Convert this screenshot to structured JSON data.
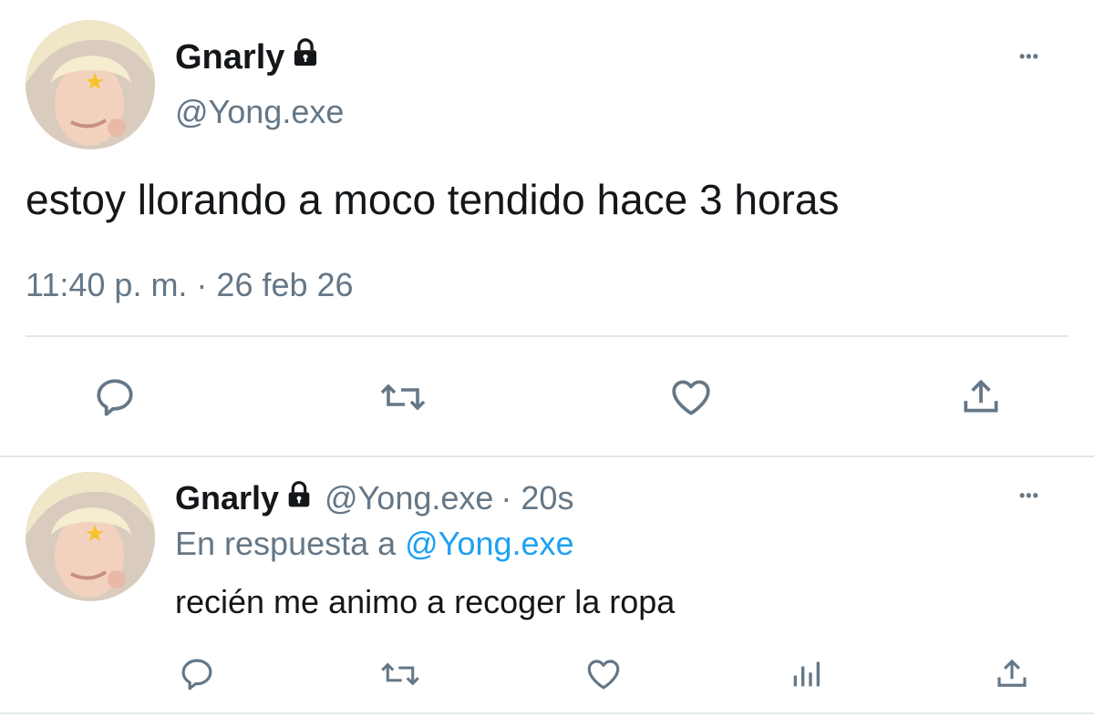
{
  "main_tweet": {
    "display_name": "Gnarly",
    "handle": "@Yong.exe",
    "text": "estoy llorando a moco tendido hace 3 horas",
    "timestamp": "11:40 p. m. · 26 feb 26",
    "avatar_icon": "user-avatar",
    "actions": [
      "reply-icon",
      "retweet-icon",
      "like-icon",
      "share-icon"
    ]
  },
  "reply_tweet": {
    "display_name": "Gnarly",
    "handle": "@Yong.exe",
    "time_ago": "· 20s",
    "replying_to_label": "En respuesta a",
    "replying_to_handle": "@Yong.exe",
    "text": "recién me animo a recoger la ropa",
    "avatar_icon": "user-avatar",
    "actions": [
      "reply-icon",
      "retweet-icon",
      "like-icon",
      "analytics-icon",
      "share-icon"
    ]
  },
  "menu_glyph": "•••",
  "colors": {
    "text": "#14171a",
    "secondary": "#657786",
    "link": "#1da1f2",
    "divider": "#e1e8ed"
  }
}
